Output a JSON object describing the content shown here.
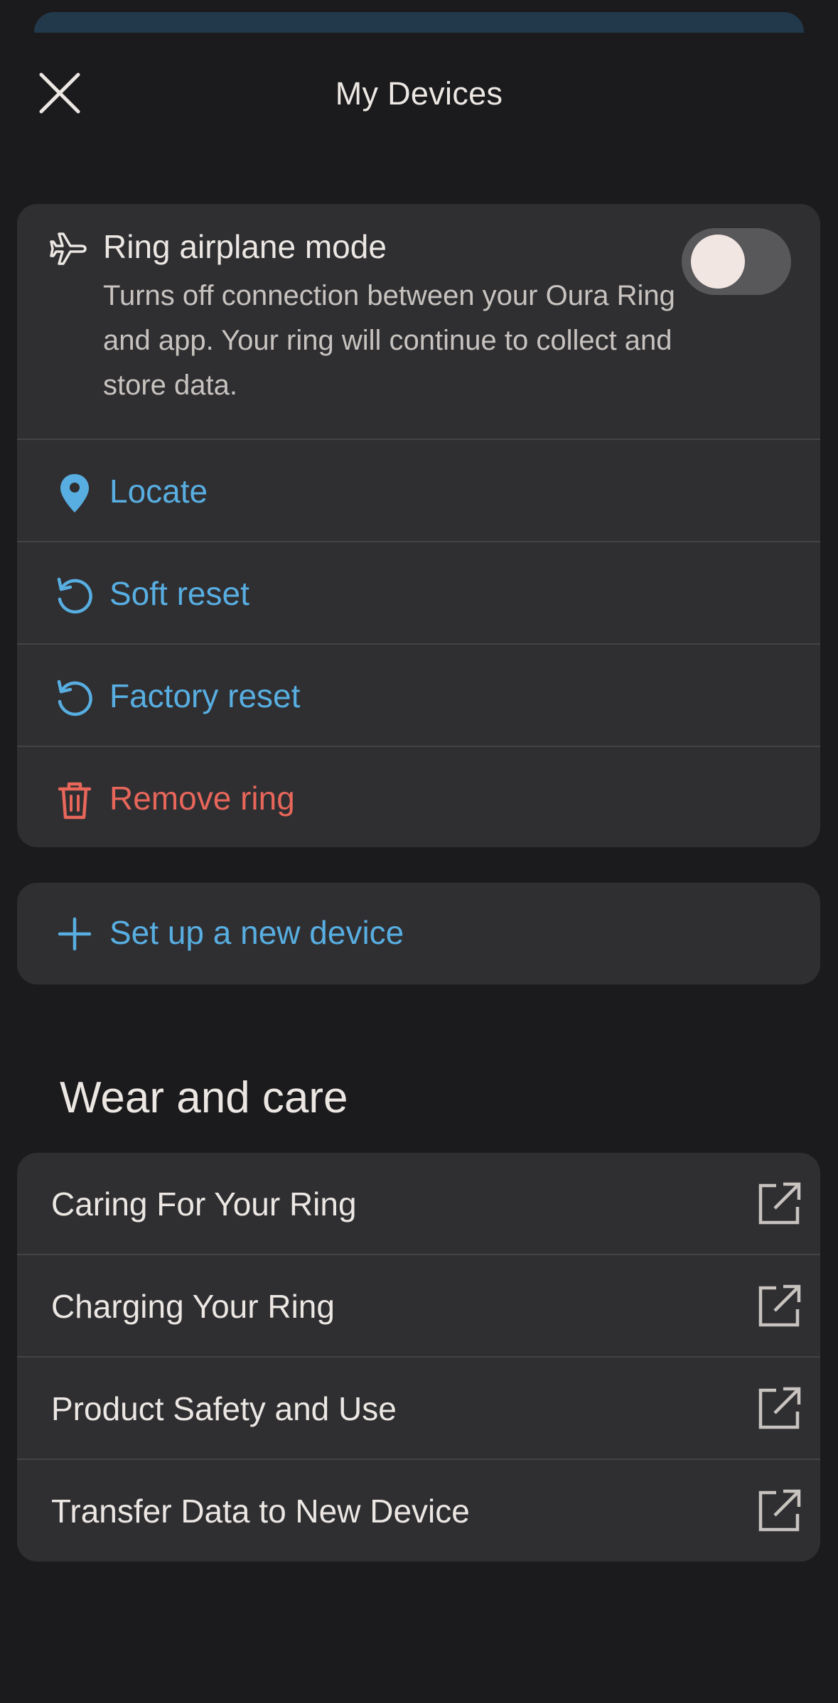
{
  "header": {
    "title": "My Devices",
    "close_icon": "close-icon"
  },
  "airplane_mode": {
    "title": "Ring airplane mode",
    "description": "Turns off connection between your Oura Ring and app. Your ring will continue to collect and store data.",
    "enabled": false,
    "icon": "airplane-icon"
  },
  "actions": [
    {
      "label": "Locate",
      "icon": "location-pin-icon"
    },
    {
      "label": "Soft reset",
      "icon": "reset-icon"
    },
    {
      "label": "Factory reset",
      "icon": "reset-icon"
    },
    {
      "label": "Remove ring",
      "icon": "trash-icon"
    }
  ],
  "setup": {
    "label": "Set up a new device",
    "icon": "plus-icon"
  },
  "wear_and_care": {
    "title": "Wear and care",
    "items": [
      {
        "label": "Caring For Your Ring",
        "icon": "external-link-icon"
      },
      {
        "label": "Charging Your Ring",
        "icon": "external-link-icon"
      },
      {
        "label": "Product Safety and Use",
        "icon": "external-link-icon"
      },
      {
        "label": "Transfer Data to New Device",
        "icon": "external-link-icon"
      }
    ]
  },
  "colors": {
    "background": "#1b1b1d",
    "card": "#2f2f32",
    "accent_blue": "#58aee1",
    "danger_red": "#e8665a",
    "text_primary": "#ece7e3"
  }
}
